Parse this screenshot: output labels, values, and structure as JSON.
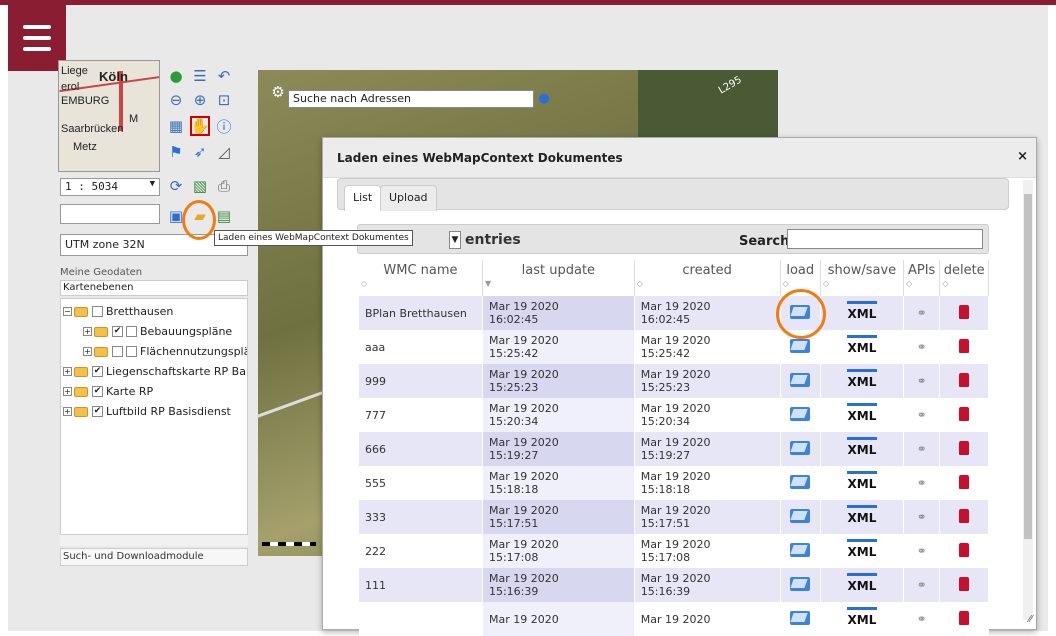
{
  "app": {
    "menu_icon": "hamburger-menu-icon",
    "brand_color": "#8b1d33"
  },
  "minimap": {
    "labels": [
      "Liege",
      "Köln",
      "erol",
      "EMBURG",
      "Saarbrücken",
      "Metz",
      "M"
    ]
  },
  "toolbar": {
    "scale_value": "1 : 5034",
    "crs_value": "UTM zone 32N",
    "tooltip": "Laden eines WebMapContext Dokumentes",
    "icons": [
      "globe-icon",
      "legend-icon",
      "back-icon",
      "zoom-out-icon",
      "zoom-in-icon",
      "zoom-extent-icon",
      "grid-icon",
      "pan-select-icon",
      "info-icon",
      "flag-icon",
      "pointer-icon",
      "measure-icon",
      "refresh-icon",
      "overview-icon",
      "print-icon",
      "save-icon",
      "open-folder-icon",
      "load-wmc-icon"
    ]
  },
  "layers": {
    "header": "Meine Geodaten",
    "subheader": "Kartenebenen",
    "items": [
      {
        "label": "Bretthausen",
        "checked": false
      },
      {
        "label": "Bebauungspläne",
        "checked": true
      },
      {
        "label": "Flächennutzungsplä",
        "checked": false
      },
      {
        "label": "Liegenschaftskarte RP Ba",
        "checked": true
      },
      {
        "label": "Karte RP",
        "checked": true
      },
      {
        "label": "Luftbild RP Basisdienst",
        "checked": true
      }
    ],
    "footer": "Such- und Downloadmodule"
  },
  "map": {
    "search_placeholder": "Suche nach Adressen",
    "road_label": "L295"
  },
  "dialog": {
    "title": "Laden eines WebMapContext Dokumentes",
    "close": "×",
    "tabs": [
      "List",
      "Upload"
    ],
    "entries_label": "entries",
    "search_label": "Search:",
    "columns": [
      "WMC name",
      "last update",
      "created",
      "load",
      "show/save",
      "APIs",
      "delete"
    ],
    "xml_label": "XML",
    "rows": [
      {
        "name": "BPlan Bretthausen",
        "updated_date": "Mar 19 2020",
        "updated_time": "16:02:45",
        "created_date": "Mar 19 2020",
        "created_time": "16:02:45"
      },
      {
        "name": "aaa",
        "updated_date": "Mar 19 2020",
        "updated_time": "15:25:42",
        "created_date": "Mar 19 2020",
        "created_time": "15:25:42"
      },
      {
        "name": "999",
        "updated_date": "Mar 19 2020",
        "updated_time": "15:25:23",
        "created_date": "Mar 19 2020",
        "created_time": "15:25:23"
      },
      {
        "name": "777",
        "updated_date": "Mar 19 2020",
        "updated_time": "15:20:34",
        "created_date": "Mar 19 2020",
        "created_time": "15:20:34"
      },
      {
        "name": "666",
        "updated_date": "Mar 19 2020",
        "updated_time": "15:19:27",
        "created_date": "Mar 19 2020",
        "created_time": "15:19:27"
      },
      {
        "name": "555",
        "updated_date": "Mar 19 2020",
        "updated_time": "15:18:18",
        "created_date": "Mar 19 2020",
        "created_time": "15:18:18"
      },
      {
        "name": "333",
        "updated_date": "Mar 19 2020",
        "updated_time": "15:17:51",
        "created_date": "Mar 19 2020",
        "created_time": "15:17:51"
      },
      {
        "name": "222",
        "updated_date": "Mar 19 2020",
        "updated_time": "15:17:08",
        "created_date": "Mar 19 2020",
        "created_time": "15:17:08"
      },
      {
        "name": "111",
        "updated_date": "Mar 19 2020",
        "updated_time": "15:16:39",
        "created_date": "Mar 19 2020",
        "created_time": "15:16:39"
      },
      {
        "name": "",
        "updated_date": "Mar 19 2020",
        "updated_time": "",
        "created_date": "Mar 19 2020",
        "created_time": ""
      }
    ]
  },
  "highlight_color": "#f07d14"
}
